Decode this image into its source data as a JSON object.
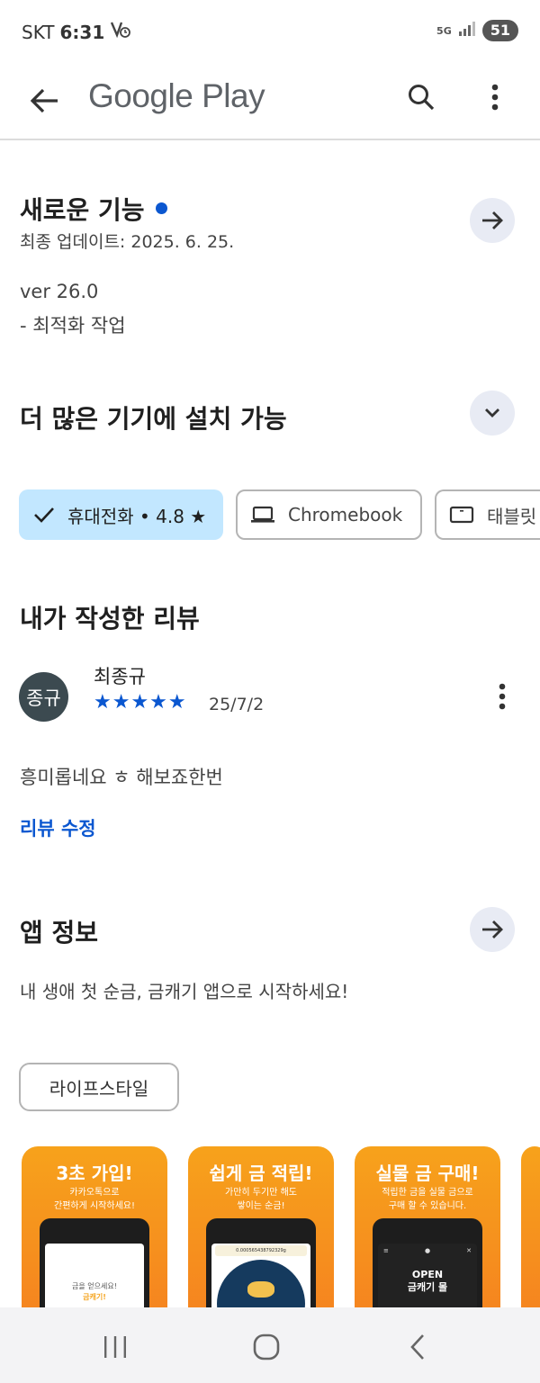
{
  "status_bar": {
    "carrier": "SKT",
    "time": "6:31",
    "network": "5G",
    "battery": "51"
  },
  "app_bar": {
    "title": "Google Play"
  },
  "whats_new": {
    "title": "새로운 기능",
    "updated": "최종 업데이트: 2025. 6. 25.",
    "version": "ver 26.0",
    "note": "- 최적화 작업"
  },
  "devices": {
    "title": "더 많은 기기에 설치 가능",
    "chips": [
      {
        "label": "휴대전화 • 4.8 ★",
        "selected": true
      },
      {
        "label": "Chromebook",
        "selected": false
      },
      {
        "label": "태블릿",
        "selected": false
      }
    ]
  },
  "my_review": {
    "title": "내가 작성한 리뷰",
    "avatar_text": "종규",
    "reviewer": "최종규",
    "rating": 5,
    "stars": "★★★★★",
    "date": "25/7/2",
    "text": "흥미롭네요 ㅎ 해보죠한번",
    "edit_label": "리뷰 수정"
  },
  "app_info": {
    "title": "앱 정보",
    "description": "내 생애 첫 순금, 금캐기 앱으로 시작하세요!",
    "category": "라이프스타일"
  },
  "screenshots": [
    {
      "headline": "3초 가입!",
      "sub": "카카오톡으로\n간편하게 시작하세요!",
      "screen_text": "금을 얻으세요!",
      "screen_brand": "금캐기!"
    },
    {
      "headline": "쉽게 금 적립!",
      "sub": "가만히 두기만 해도\n쌓이는 순금!",
      "screen_text": "0.000565438792329g"
    },
    {
      "headline": "실물 금 구매!",
      "sub": "적립한 금을 실물 금으로\n구매 할 수 있습니다.",
      "screen_text": "OPEN\n금캐기 몰"
    }
  ],
  "colors": {
    "accent": "#0b57d0",
    "chip_selected": "#c2e7ff",
    "arrow_button_bg": "#e8ebf4",
    "avatar_bg": "#3c4a50",
    "screenshot_orange": "#f7a21b"
  }
}
